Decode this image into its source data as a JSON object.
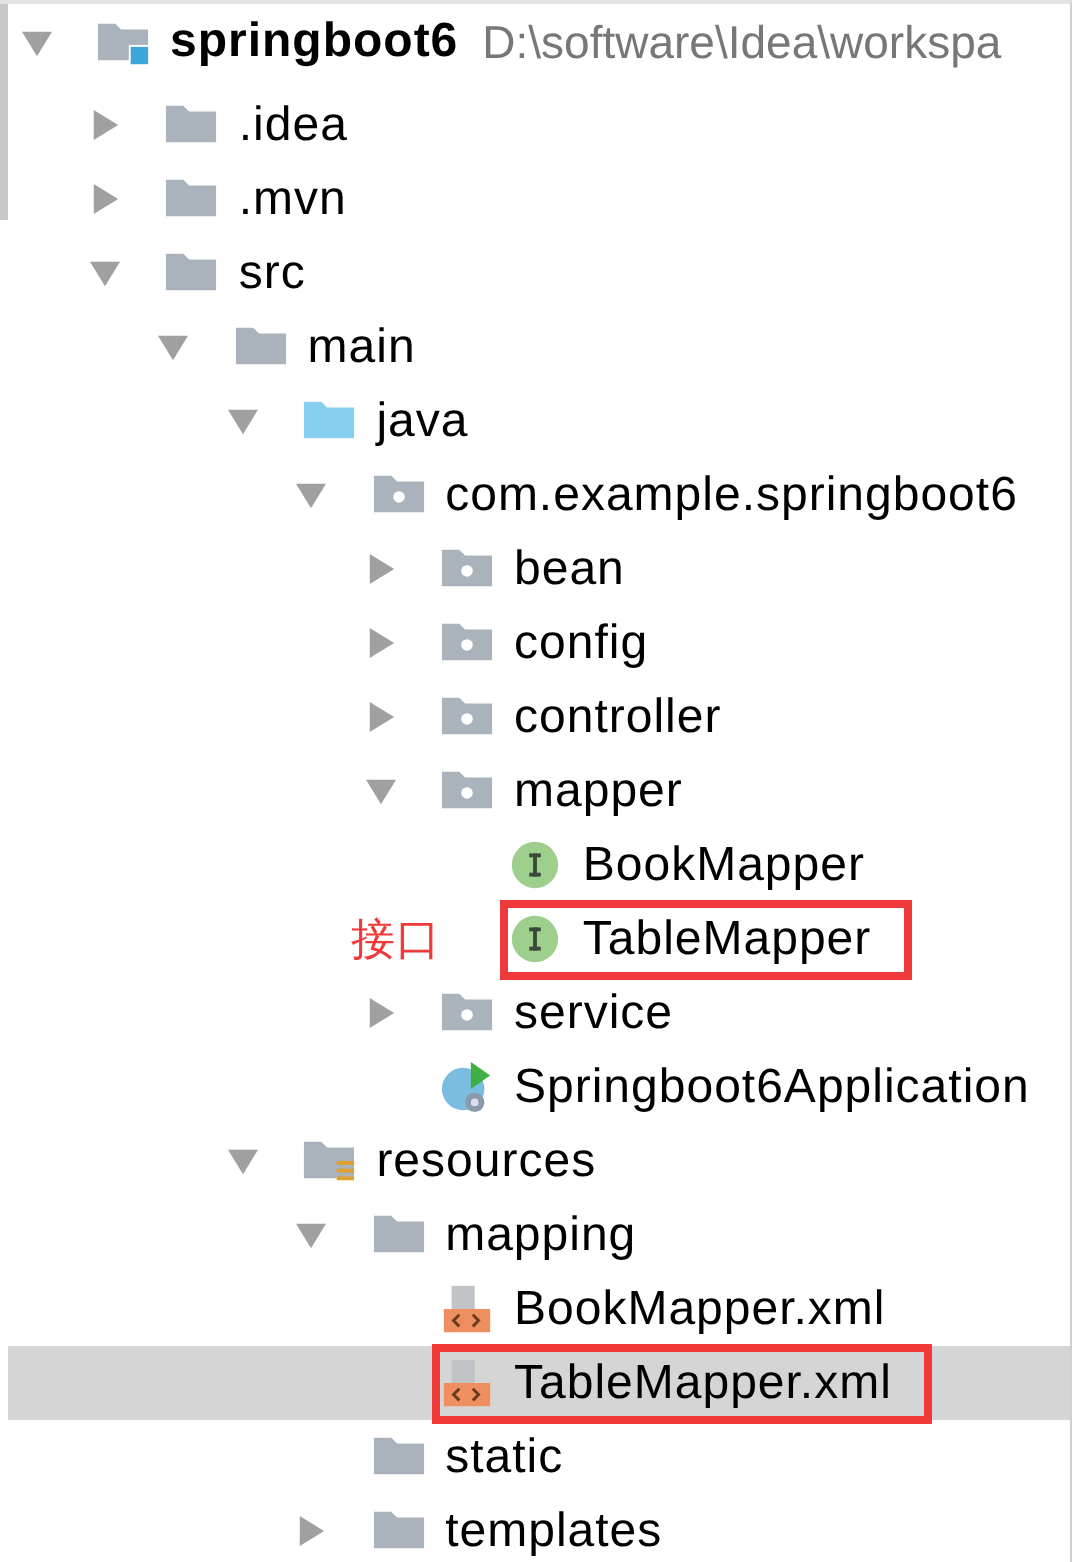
{
  "tree": [
    {
      "label": "springboot6",
      "kind": "project",
      "path": "D:\\software\\Idea\\workspa",
      "expanded": true,
      "selected": false,
      "highlighted": false,
      "children": [
        {
          "label": ".idea",
          "kind": "folder",
          "expanded": false,
          "selected": false,
          "highlighted": false
        },
        {
          "label": ".mvn",
          "kind": "folder",
          "expanded": false,
          "selected": false,
          "highlighted": false
        },
        {
          "label": "src",
          "kind": "folder",
          "expanded": true,
          "selected": false,
          "highlighted": false,
          "children": [
            {
              "label": "main",
              "kind": "folder",
              "expanded": true,
              "selected": false,
              "highlighted": false,
              "children": [
                {
                  "label": "java",
                  "kind": "source-folder",
                  "expanded": true,
                  "selected": false,
                  "highlighted": false,
                  "children": [
                    {
                      "label": "com.example.springboot6",
                      "kind": "package",
                      "expanded": true,
                      "selected": false,
                      "highlighted": false,
                      "children": [
                        {
                          "label": "bean",
                          "kind": "package",
                          "expanded": false,
                          "selected": false,
                          "highlighted": false
                        },
                        {
                          "label": "config",
                          "kind": "package",
                          "expanded": false,
                          "selected": false,
                          "highlighted": false
                        },
                        {
                          "label": "controller",
                          "kind": "package",
                          "expanded": false,
                          "selected": false,
                          "highlighted": false
                        },
                        {
                          "label": "mapper",
                          "kind": "package",
                          "expanded": true,
                          "selected": false,
                          "highlighted": false,
                          "children": [
                            {
                              "label": "BookMapper",
                              "kind": "interface",
                              "selected": false,
                              "highlighted": false
                            },
                            {
                              "label": "TableMapper",
                              "kind": "interface",
                              "selected": false,
                              "highlighted": true,
                              "note": "接口"
                            }
                          ]
                        },
                        {
                          "label": "service",
                          "kind": "package",
                          "expanded": false,
                          "selected": false,
                          "highlighted": false
                        },
                        {
                          "label": "Springboot6Application",
                          "kind": "app",
                          "selected": false,
                          "highlighted": false
                        }
                      ]
                    }
                  ]
                },
                {
                  "label": "resources",
                  "kind": "resources",
                  "expanded": true,
                  "selected": false,
                  "highlighted": false,
                  "children": [
                    {
                      "label": "mapping",
                      "kind": "folder",
                      "expanded": true,
                      "selected": false,
                      "highlighted": false,
                      "children": [
                        {
                          "label": "BookMapper.xml",
                          "kind": "xml",
                          "selected": false,
                          "highlighted": false
                        },
                        {
                          "label": "TableMapper.xml",
                          "kind": "xml",
                          "selected": true,
                          "highlighted": true
                        }
                      ]
                    },
                    {
                      "label": "static",
                      "kind": "folder",
                      "selected": false,
                      "highlighted": false
                    },
                    {
                      "label": "templates",
                      "kind": "folder",
                      "expanded": false,
                      "selected": false,
                      "highlighted": false
                    }
                  ]
                }
              ]
            }
          ]
        }
      ]
    }
  ]
}
